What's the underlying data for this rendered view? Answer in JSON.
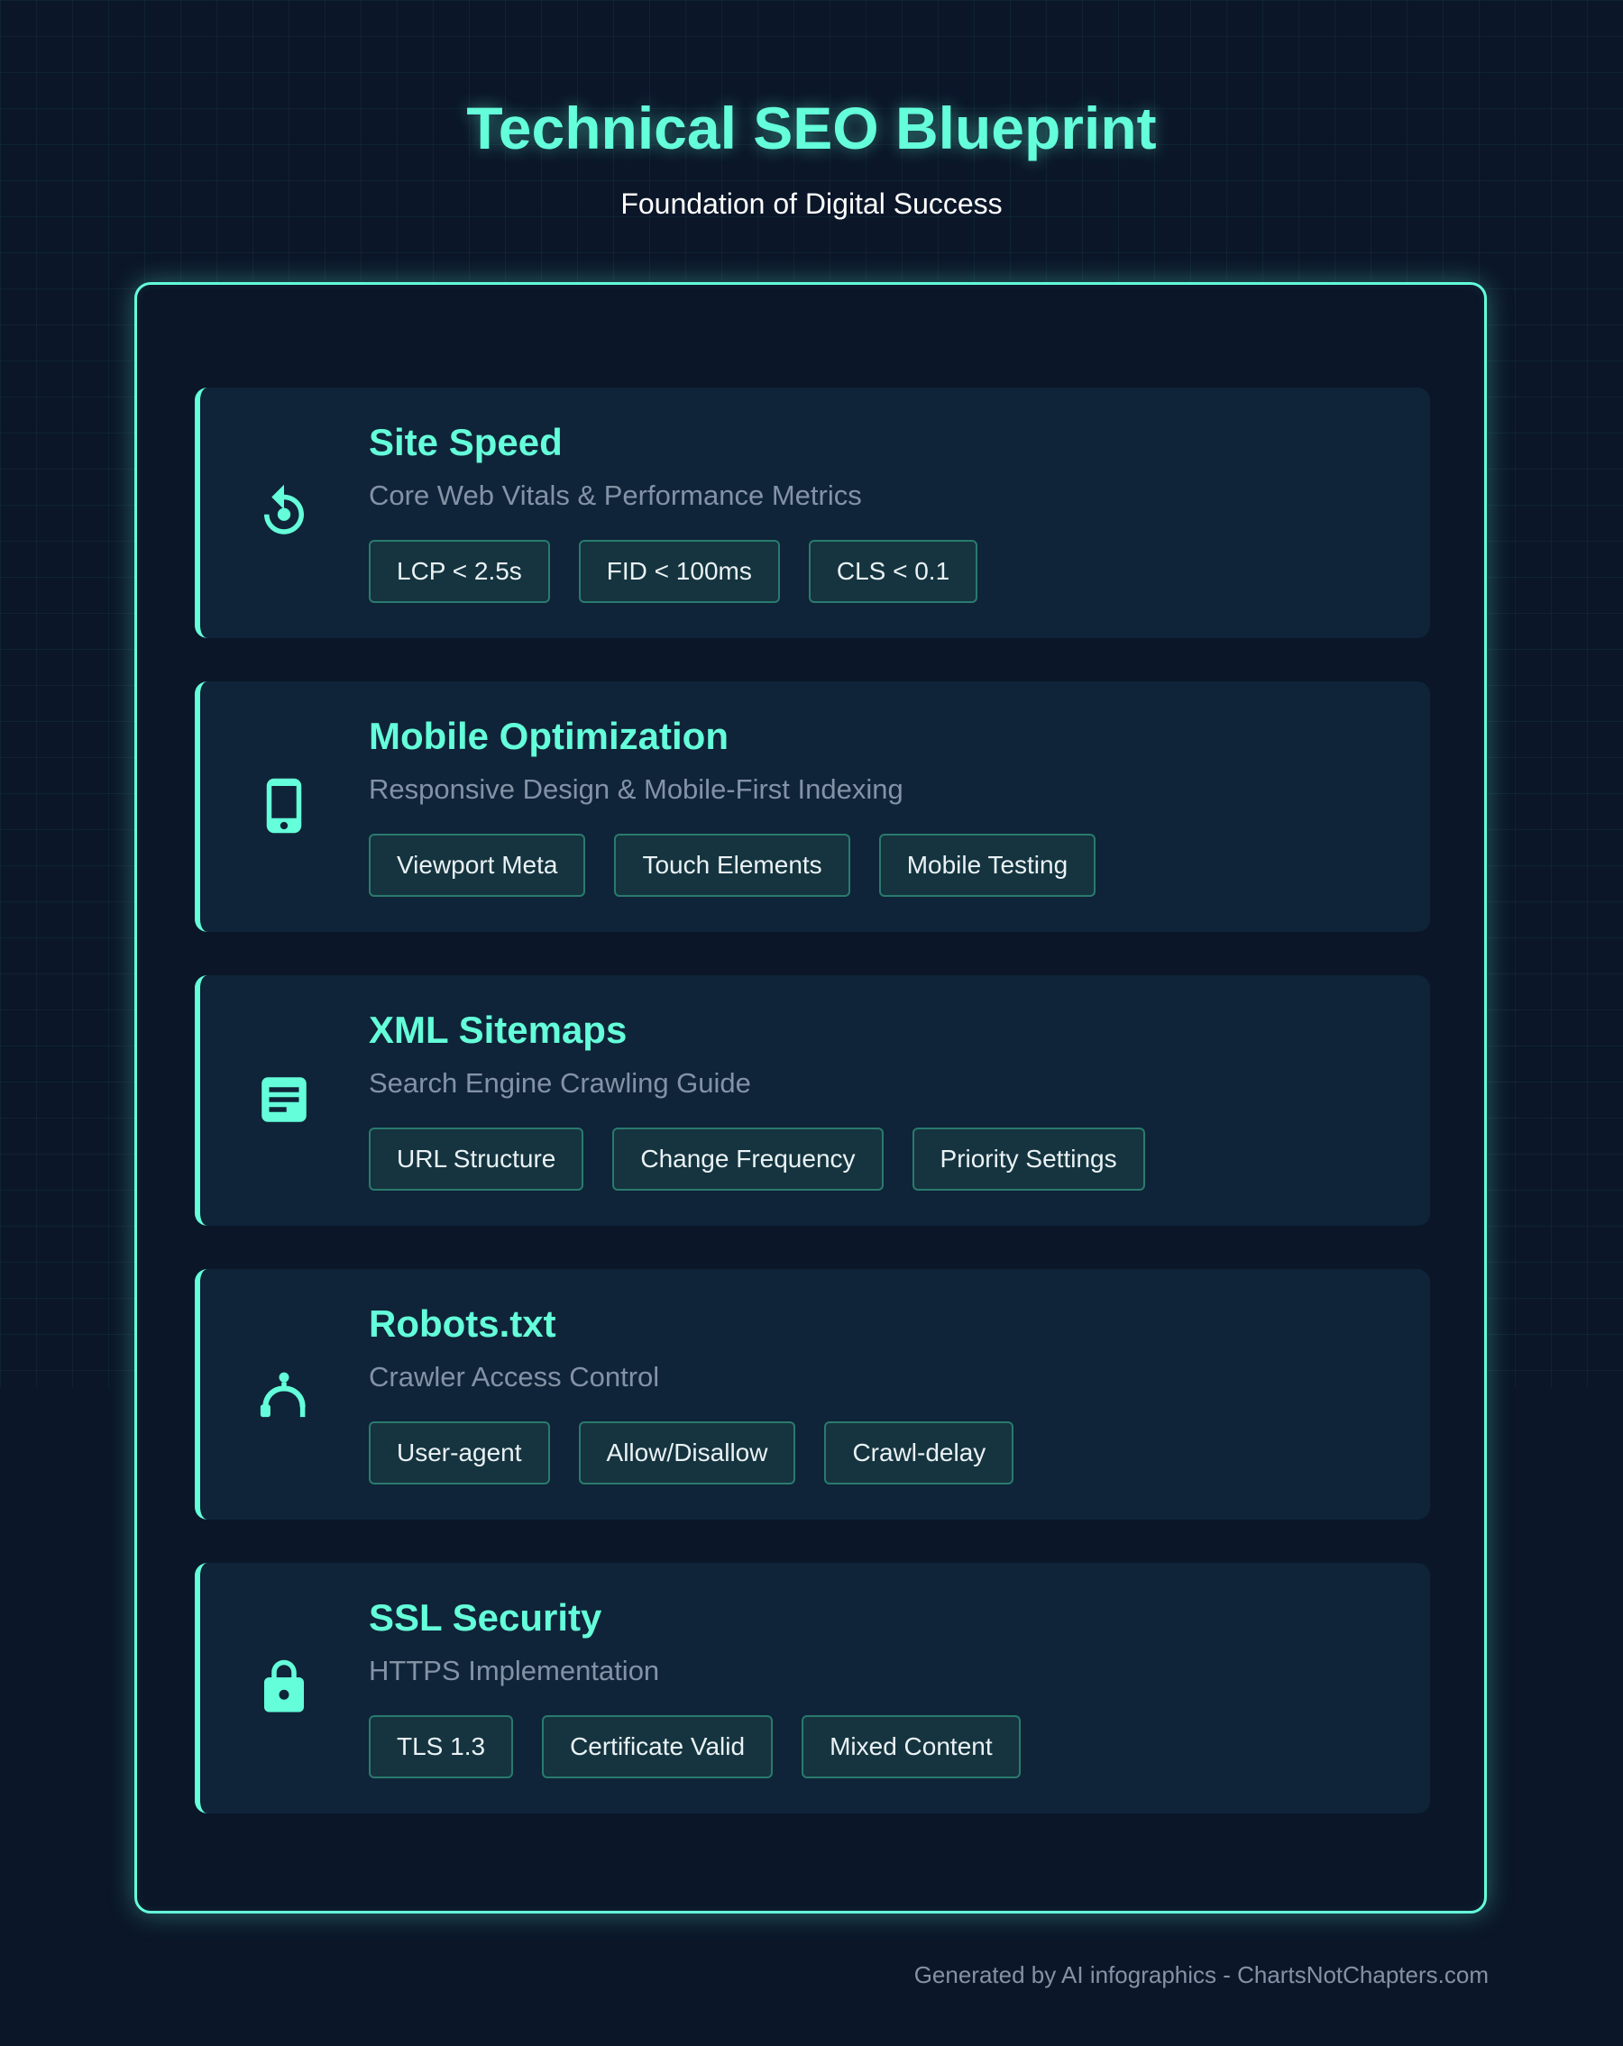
{
  "page": {
    "title": "Technical SEO Blueprint",
    "subtitle": "Foundation of Digital Success",
    "footer": "Generated by AI infographics - ChartsNotChapters.com"
  },
  "colors": {
    "accent": "#64ffda",
    "background": "#0b1629",
    "card": "#0f2438",
    "muted_text": "#8492a6"
  },
  "cards": [
    {
      "icon": "speed-icon",
      "title": "Site Speed",
      "subtitle": "Core Web Vitals & Performance Metrics",
      "tags": [
        "LCP < 2.5s",
        "FID < 100ms",
        "CLS < 0.1"
      ]
    },
    {
      "icon": "smartphone-icon",
      "title": "Mobile Optimization",
      "subtitle": "Responsive Design & Mobile-First Indexing",
      "tags": [
        "Viewport Meta",
        "Touch Elements",
        "Mobile Testing"
      ]
    },
    {
      "icon": "sitemap-icon",
      "title": "XML Sitemaps",
      "subtitle": "Search Engine Crawling Guide",
      "tags": [
        "URL Structure",
        "Change Frequency",
        "Priority Settings"
      ]
    },
    {
      "icon": "robot-icon",
      "title": "Robots.txt",
      "subtitle": "Crawler Access Control",
      "tags": [
        "User-agent",
        "Allow/Disallow",
        "Crawl-delay"
      ]
    },
    {
      "icon": "lock-icon",
      "title": "SSL Security",
      "subtitle": "HTTPS Implementation",
      "tags": [
        "TLS 1.3",
        "Certificate Valid",
        "Mixed Content"
      ]
    }
  ]
}
